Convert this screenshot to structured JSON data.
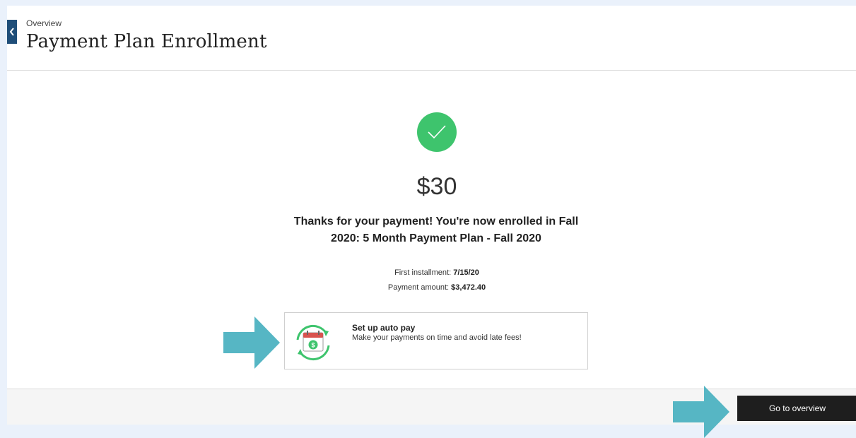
{
  "header": {
    "breadcrumb": "Overview",
    "title": "Payment Plan Enrollment"
  },
  "confirmation": {
    "amount": "$30",
    "message": "Thanks for your payment! You're now enrolled in Fall 2020: 5 Month Payment Plan - Fall 2020",
    "first_installment_label": "First installment:",
    "first_installment_value": "7/15/20",
    "payment_amount_label": "Payment amount:",
    "payment_amount_value": "$3,472.40"
  },
  "autopay": {
    "title": "Set up auto pay",
    "description": "Make your payments on time and avoid late fees!",
    "icon": "calendar-dollar-autopay-icon"
  },
  "footer": {
    "go_button_label": "Go to overview"
  },
  "colors": {
    "success": "#3ec46d",
    "back_tab": "#1f4e79",
    "arrow": "#56b6c4",
    "button": "#1e1e1e"
  },
  "icons": {
    "back": "chevron-left-icon",
    "success": "checkmark-icon",
    "annotation": "arrow-right-icon"
  }
}
